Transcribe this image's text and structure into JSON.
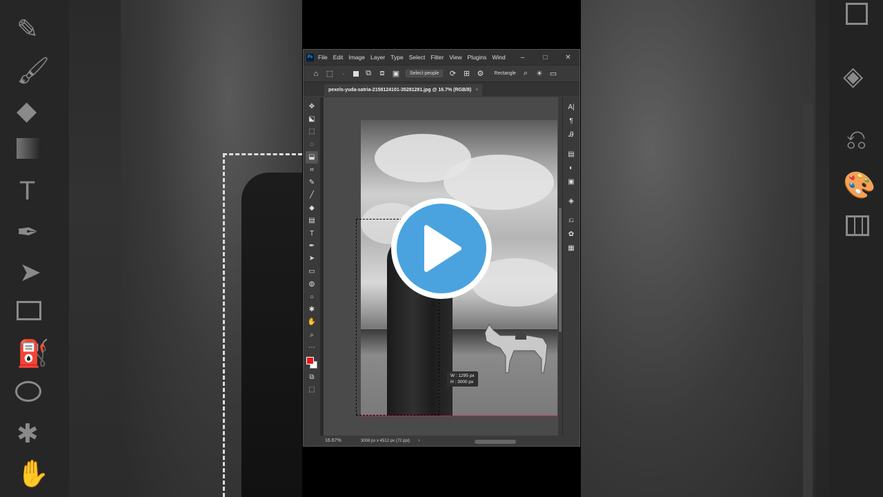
{
  "menu": [
    "File",
    "Edit",
    "Image",
    "Layer",
    "Type",
    "Select",
    "Filter",
    "View",
    "Plugins",
    "Wind"
  ],
  "window_controls": {
    "minimize": "–",
    "maximize": "□",
    "close": "✕"
  },
  "app_logo": "Ps",
  "options_bar": {
    "select_people_label": "Select people",
    "mode_label": "Rectangle"
  },
  "document_tab": {
    "title": "pexels-yuda-satria-2158124101-35281281.jpg @ 16.7% (RGB/8)",
    "close": "×"
  },
  "selection_info": {
    "width": "W :  1295 px",
    "height": "H :  3000 px"
  },
  "status_bar": {
    "zoom": "16.67%",
    "doc_info": "3008 px x 4512 px (72 ppi)",
    "arrow": "›"
  },
  "colors": {
    "foreground": "#e01b1b",
    "background": "#ffffff",
    "play_button": "#4aa3df"
  },
  "icons": {
    "tools": [
      "move-icon",
      "artboard-icon",
      "marquee-icon",
      "lasso-icon",
      "object-select-icon",
      "crop-icon",
      "eyedropper-icon",
      "brush-icon",
      "eraser-icon",
      "gradient-icon",
      "type-icon",
      "pen-icon",
      "path-select-icon",
      "rectangle-icon",
      "paint-bucket-icon",
      "ellipse-icon",
      "shape-icon",
      "hand-icon",
      "zoom-icon",
      "more-icon"
    ],
    "panels": [
      "character-icon",
      "paragraph-icon",
      "glyphs-icon",
      "libraries-icon",
      "adjustments-icon",
      "properties-icon",
      "layers-icon",
      "history-icon",
      "color-icon",
      "swatches-icon"
    ]
  }
}
